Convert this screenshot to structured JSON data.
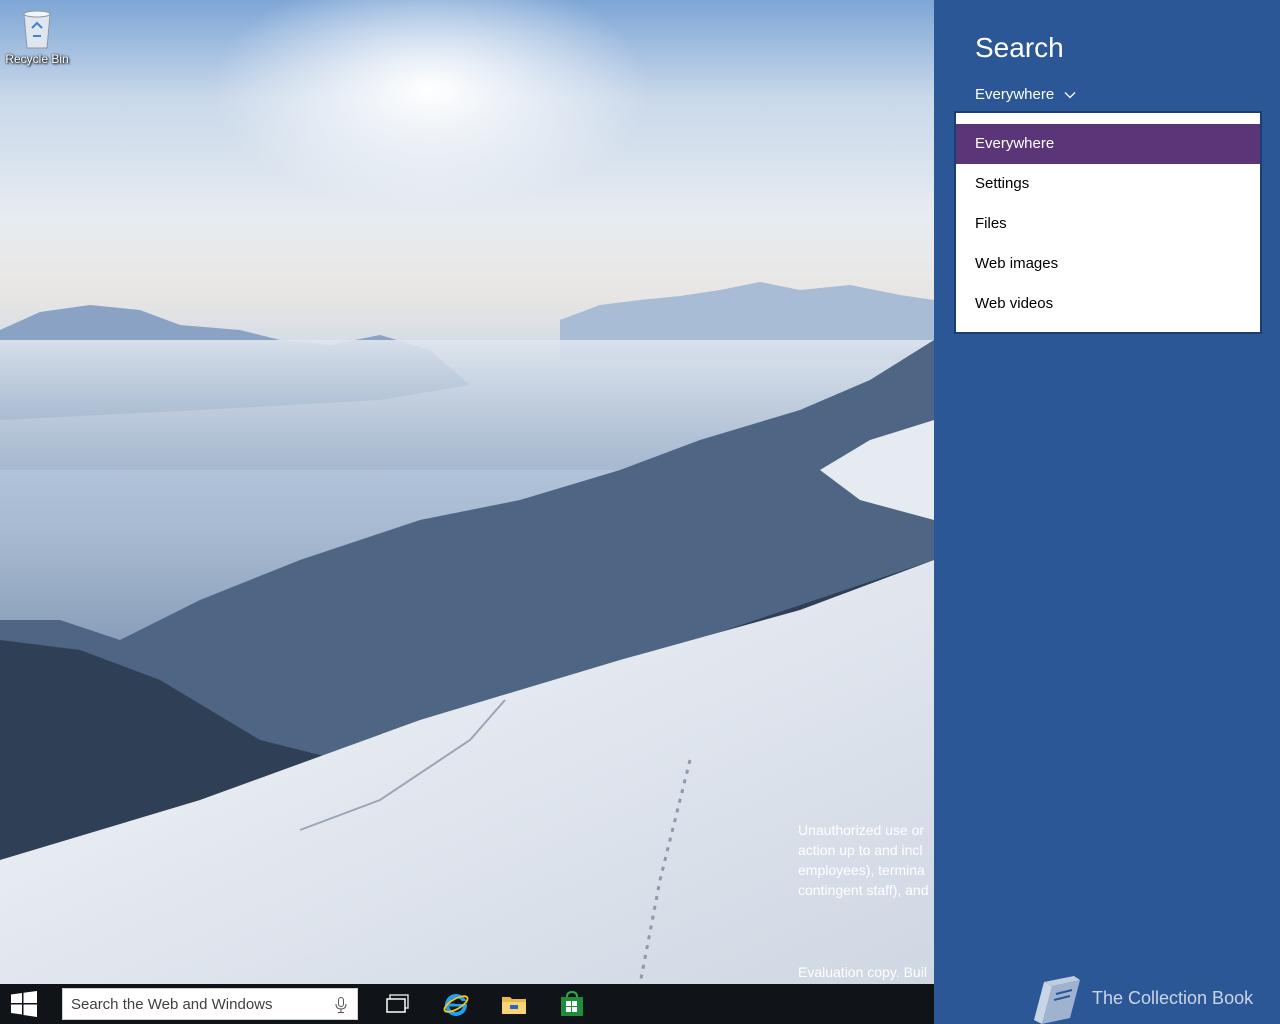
{
  "desktop": {
    "recycle_bin_label": "Recycle Bin",
    "legal_lines": [
      "Unauthorized use or",
      "action up to and incl",
      "employees), termina",
      "contingent staff), and"
    ],
    "evaluation_notice": "Evaluation copy. Buil"
  },
  "taskbar": {
    "search_placeholder": "Search the Web and Windows",
    "apps": [
      "task-view",
      "internet-explorer",
      "file-explorer",
      "store"
    ]
  },
  "search_charm": {
    "title": "Search",
    "scope_label": "Everywhere",
    "options": [
      "Everywhere",
      "Settings",
      "Files",
      "Web images",
      "Web videos"
    ],
    "selected": "Everywhere"
  },
  "watermark": {
    "text": "The Collection Book"
  },
  "colors": {
    "charm_bg": "#2b5797",
    "selected_item": "#5a3578",
    "taskbar": "#101418"
  }
}
